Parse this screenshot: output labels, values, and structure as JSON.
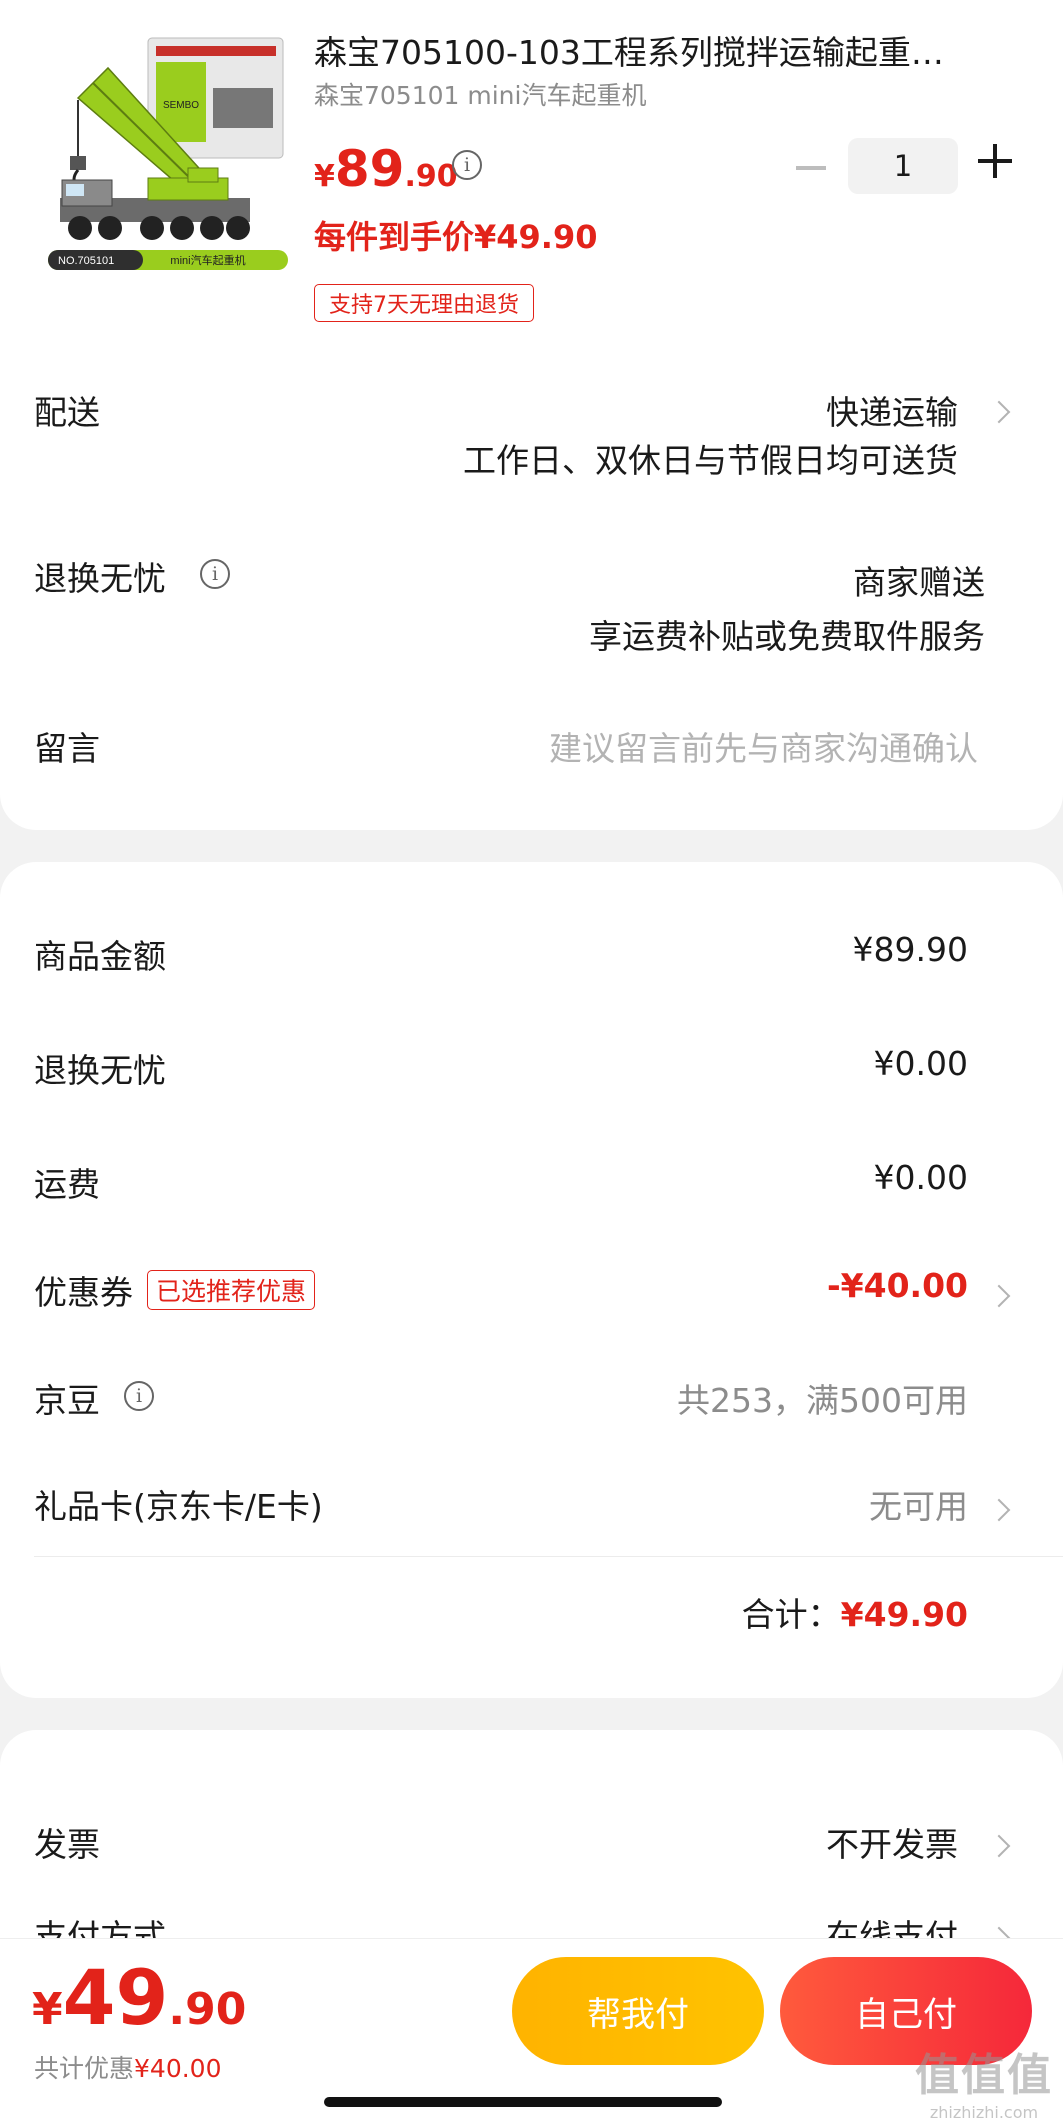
{
  "product": {
    "title": "森宝705100-103工程系列搅拌运输起重…",
    "spec": "森宝705101 mini汽车起重机",
    "price_currency": "¥",
    "price_int": "89",
    "price_dec": ".90",
    "quantity": "1",
    "final_price": "每件到手价¥49.90",
    "return_badge": "支持7天无理由退货",
    "image_box_label": "NO.705101",
    "image_box_caption": "mini汽车起重机",
    "image_box_brand": "SEMBO"
  },
  "delivery": {
    "label": "配送",
    "method": "快递运输",
    "detail": "工作日、双休日与节假日均可送货"
  },
  "return_worry": {
    "label": "退换无忧",
    "value": "商家赠送",
    "detail": "享运费补贴或免费取件服务"
  },
  "message": {
    "label": "留言",
    "placeholder": "建议留言前先与商家沟通确认"
  },
  "summary": {
    "goods_label": "商品金额",
    "goods_value": "¥89.90",
    "return_label": "退换无忧",
    "return_value": "¥0.00",
    "shipping_label": "运费",
    "shipping_value": "¥0.00",
    "coupon_label": "优惠券",
    "coupon_tag": "已选推荐优惠",
    "coupon_value": "-¥40.00",
    "jingdou_label": "京豆",
    "jingdou_value": "共253，满500可用",
    "giftcard_label": "礼品卡(京东卡/E卡)",
    "giftcard_value": "无可用",
    "total_label": "合计：",
    "total_value": "¥49.90"
  },
  "invoice": {
    "label": "发票",
    "value": "不开发票"
  },
  "payment": {
    "label": "支付方式",
    "value": "在线支付"
  },
  "bottom": {
    "currency": "¥",
    "total_int": "49",
    "total_dec": ".90",
    "saving_prefix": "共计优惠",
    "saving_value": "¥40.00",
    "help_pay": "帮我付",
    "self_pay": "自己付"
  },
  "watermark": {
    "big": "值值值",
    "small": "zhizhizhi.com"
  },
  "colors": {
    "accent_red": "#e2231a",
    "help_btn": "#ffb300",
    "self_btn": "#f5283a",
    "crane_green": "#9acd1e"
  }
}
